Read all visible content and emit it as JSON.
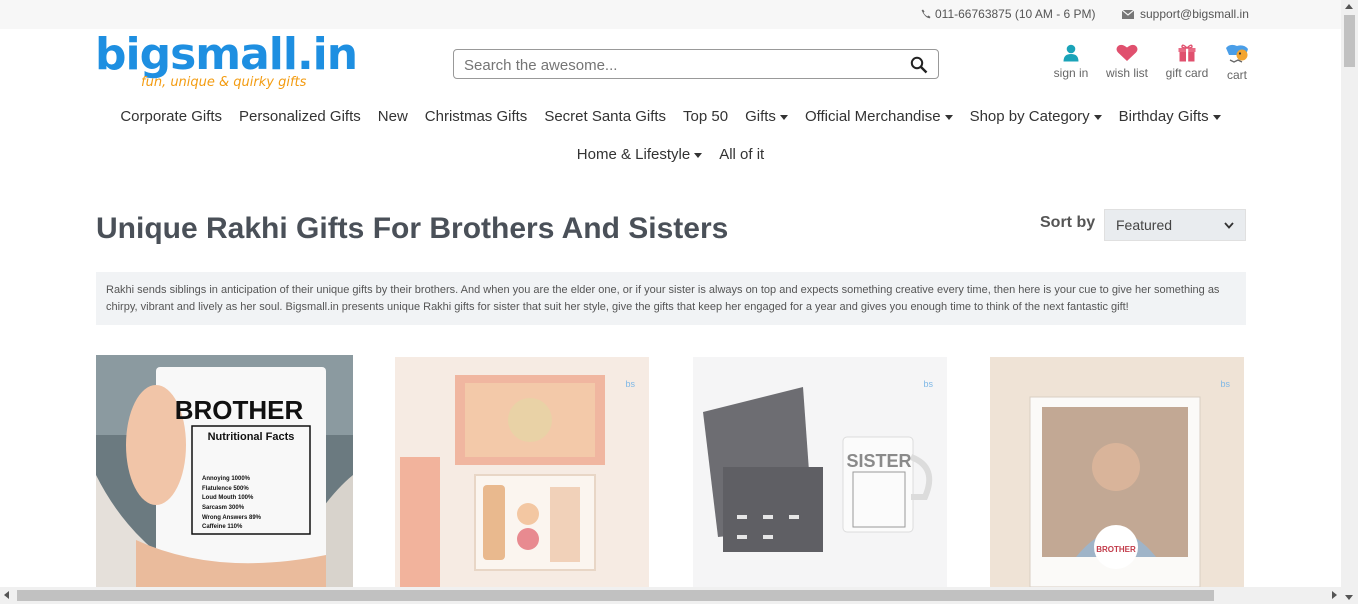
{
  "topbar": {
    "phone": "011-66763875 (10 AM - 6 PM)",
    "email": "support@bigsmall.in"
  },
  "logo": {
    "name": "bigsmall.in",
    "tagline": "fun, unique & quirky gifts"
  },
  "search": {
    "placeholder": "Search the awesome..."
  },
  "user_icons": {
    "signin": "sign in",
    "wishlist": "wish list",
    "giftcard": "gift card",
    "cart": "cart"
  },
  "nav": {
    "row1": [
      {
        "label": "Corporate Gifts",
        "dropdown": false
      },
      {
        "label": "Personalized Gifts",
        "dropdown": false
      },
      {
        "label": "New",
        "dropdown": false
      },
      {
        "label": "Christmas Gifts",
        "dropdown": false
      },
      {
        "label": "Secret Santa Gifts",
        "dropdown": false
      },
      {
        "label": "Top 50",
        "dropdown": false
      },
      {
        "label": "Gifts",
        "dropdown": true
      },
      {
        "label": "Official Merchandise",
        "dropdown": true
      },
      {
        "label": "Shop by Category",
        "dropdown": true
      },
      {
        "label": "Birthday Gifts",
        "dropdown": true
      }
    ],
    "row2": [
      {
        "label": "Home & Lifestyle",
        "dropdown": true
      },
      {
        "label": "All of it",
        "dropdown": false
      }
    ]
  },
  "page": {
    "title": "Unique Rakhi Gifts For Brothers And Sisters",
    "sort_label": "Sort by",
    "sort_value": "Featured",
    "description": "Rakhi sends siblings in anticipation of their unique gifts by their brothers. And when you are the elder one, or if your sister is always on top and expects something creative every time, then here is your cue to give her something as chirpy, vibrant and lively as her soul. Bigsmall.in presents unique Rakhi gifts for sister that suit her style, give the gifts that keep her engaged for a year and gives you enough time to think of the next fantastic gift!"
  },
  "products": [
    {
      "image": "brother-nutritional-facts-mug",
      "mug_title": "BROTHER",
      "facts_title": "Nutritional Facts",
      "facts_rows": [
        "Annoying 1000%",
        "Flatulence 500%",
        "Loud Mouth 100%",
        "Sarcasm 300%",
        "Wrong Answers 89%",
        "Caffeine 110%"
      ]
    },
    {
      "image": "rakhi-gift-box-colorful"
    },
    {
      "image": "sister-mug-gift-box",
      "mug_title": "SISTER"
    },
    {
      "image": "brother-photo-frame",
      "frame_label": "BROTHER"
    }
  ],
  "colors": {
    "brand_blue": "#1e8fe1",
    "brand_orange": "#f39c12",
    "heart": "#e0506e",
    "title": "#4a5058"
  }
}
